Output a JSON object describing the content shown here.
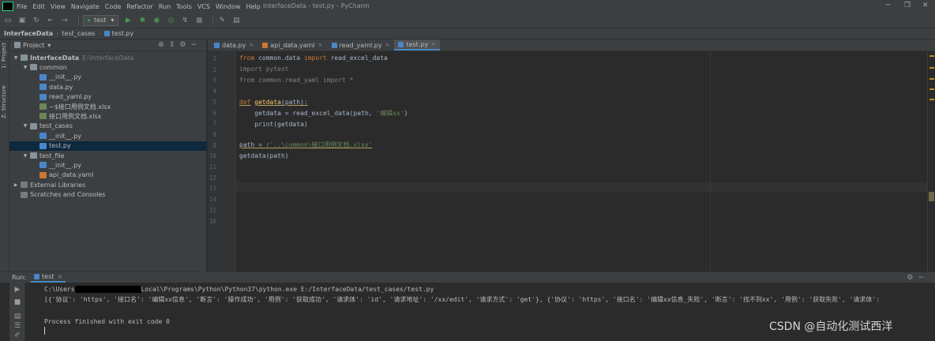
{
  "window": {
    "title": "InterfaceData - test.py - PyCharm",
    "menu": [
      "File",
      "Edit",
      "View",
      "Navigate",
      "Code",
      "Refactor",
      "Run",
      "Tools",
      "VCS",
      "Window",
      "Help"
    ],
    "controls": {
      "minimize": "─",
      "maximize": "❐",
      "close": "✕"
    }
  },
  "toolbar": {
    "run_config": "test",
    "run_config_arrow": "▾"
  },
  "breadcrumb": [
    "InterfaceData",
    "test_cases",
    "test.py"
  ],
  "project_panel": {
    "title": "Project",
    "title_arrow": "▾",
    "tree": [
      {
        "label": "InterfaceData",
        "hint": "E:\\InterfaceData",
        "type": "folder",
        "arrow": "▼",
        "depth": 0,
        "bold": true
      },
      {
        "label": "common",
        "type": "folder",
        "arrow": "▼",
        "depth": 1
      },
      {
        "label": "__init__.py",
        "type": "py",
        "arrow": "",
        "depth": 2
      },
      {
        "label": "data.py",
        "type": "py",
        "arrow": "",
        "depth": 2
      },
      {
        "label": "read_yaml.py",
        "type": "py",
        "arrow": "",
        "depth": 2
      },
      {
        "label": "~$接口用例文档.xlsx",
        "type": "xlsx",
        "arrow": "",
        "depth": 2
      },
      {
        "label": "接口用例文档.xlsx",
        "type": "xlsx",
        "arrow": "",
        "depth": 2
      },
      {
        "label": "test_cases",
        "type": "folder",
        "arrow": "▼",
        "depth": 1
      },
      {
        "label": "__init__.py",
        "type": "py",
        "arrow": "",
        "depth": 2
      },
      {
        "label": "test.py",
        "type": "py",
        "arrow": "",
        "depth": 2,
        "selected": true
      },
      {
        "label": "test_file",
        "type": "folder",
        "arrow": "▼",
        "depth": 1
      },
      {
        "label": "__init__.py",
        "type": "py",
        "arrow": "",
        "depth": 2
      },
      {
        "label": "api_data.yaml",
        "type": "yaml",
        "arrow": "",
        "depth": 2
      },
      {
        "label": "External Libraries",
        "type": "lib",
        "arrow": "▶",
        "depth": 0
      },
      {
        "label": "Scratches and Consoles",
        "type": "lib",
        "arrow": "",
        "depth": 0
      }
    ]
  },
  "side_tabs": {
    "project": "1: Project",
    "structure": "Z: Structure"
  },
  "editor": {
    "tabs": [
      {
        "label": "data.py",
        "type": "py"
      },
      {
        "label": "api_data.yaml",
        "type": "yaml"
      },
      {
        "label": "read_yaml.py",
        "type": "py"
      },
      {
        "label": "test.py",
        "type": "py",
        "active": true
      }
    ],
    "tab_close": "×",
    "line_numbers": [
      "1",
      "2",
      "3",
      "4",
      "5",
      "6",
      "7",
      "8",
      "9",
      "10",
      "11",
      "12",
      "13",
      "14",
      "15",
      "16"
    ],
    "code": {
      "l1": {
        "kw1": "from",
        "mod": " common.data ",
        "kw2": "import",
        "name": " read_excel_data"
      },
      "l2": "import pytest",
      "l3": "from common.read_yaml import *",
      "l5": {
        "kw": "def",
        "sp": " ",
        "fn": "getdata",
        "rest": "(path):"
      },
      "l6": {
        "pre": "    getdata = read_excel_data(path, ",
        "str": "'编辑xx'",
        "post": ")"
      },
      "l7": "    print(getdata)",
      "l9": {
        "pre": "path = ",
        "str": "r'..\\common\\接口用例文档.xlsx'"
      },
      "l10": "getdata(path)"
    }
  },
  "run_panel": {
    "label": "Run:",
    "tab": "test",
    "cmd_prefix": "C:\\Users",
    "cmd_suffix": "Local\\Programs\\Python\\Python37\\python.exe E:/InterfaceData/test_cases/test.py",
    "output": "[{'协议': 'https', '接口名': '编辑xx信息', '断言': '操作成功', '用例': '获取成功', '请求体': 'id', '请求地址': '/xx/edit', '请求方式': 'get'}, {'协议': 'https', '接口名': '编辑xx信息_失败', '断言': '找不到xx', '用例': '获取失败', '请求体': ",
    "exit": "Process finished with exit code 0"
  },
  "watermark": "CSDN @自动化测试西洋"
}
